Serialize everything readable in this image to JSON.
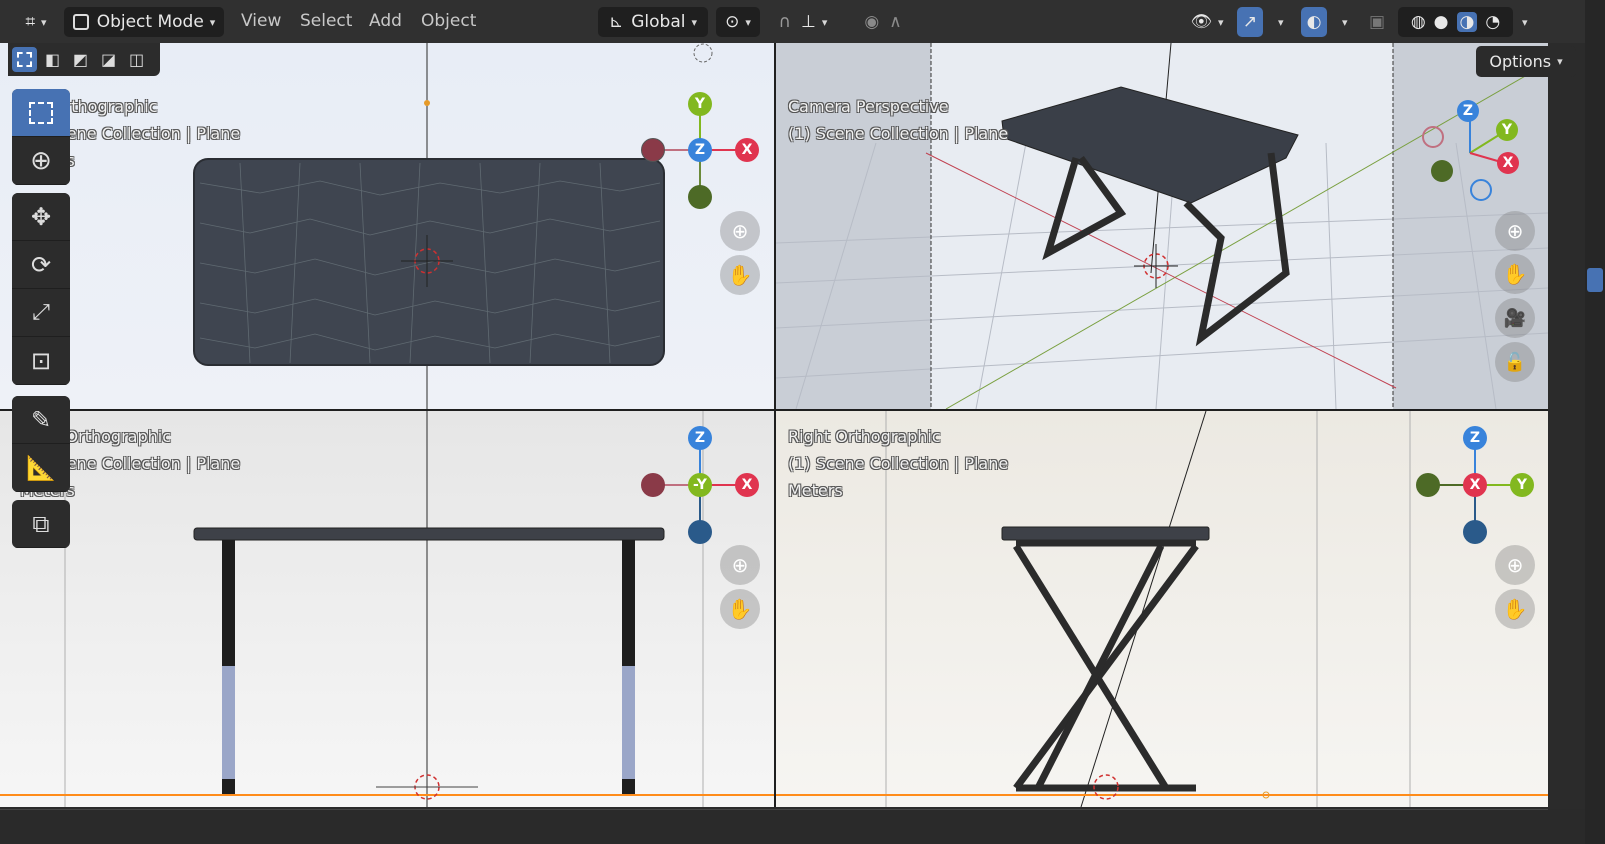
{
  "header": {
    "mode_label": "Object Mode",
    "menus": [
      "View",
      "Select",
      "Add",
      "Object"
    ],
    "transform_orientation": "Global"
  },
  "options_label": "Options",
  "viewports": {
    "top": {
      "name": "Top Orthographic",
      "collection": "(1) Scene Collection | Plane",
      "units": "Meters"
    },
    "camera": {
      "name": "Camera Perspective",
      "collection": "(1) Scene Collection | Plane"
    },
    "front": {
      "name": "Front Orthographic",
      "collection": "(1) Scene Collection | Plane",
      "units": "Meters"
    },
    "right": {
      "name": "Right Orthographic",
      "collection": "(1) Scene Collection | Plane",
      "units": "Meters"
    }
  },
  "gizmo": {
    "top": {
      "up": "Y",
      "center": "Z",
      "right": "X"
    },
    "camera": {
      "up": "Z",
      "right_upper": "Y",
      "right": "X"
    },
    "front": {
      "up": "Z",
      "center": "-Y",
      "right": "X"
    },
    "right": {
      "up": "Z",
      "center": "X",
      "right": "Y"
    }
  },
  "colors": {
    "x": "#e0344f",
    "y": "#82b81f",
    "z": "#3883db",
    "accent": "#4772b3",
    "active_border": "#ff8c1a"
  },
  "icons": {
    "toolbar": [
      "select-box-icon",
      "cursor-icon",
      "move-icon",
      "rotate-icon",
      "scale-icon",
      "transform-icon",
      "annotate-icon",
      "measure-icon",
      "add-cube-icon"
    ],
    "navigation": [
      "zoom-icon",
      "pan-hand-icon",
      "camera-view-icon",
      "lock-icon"
    ]
  }
}
